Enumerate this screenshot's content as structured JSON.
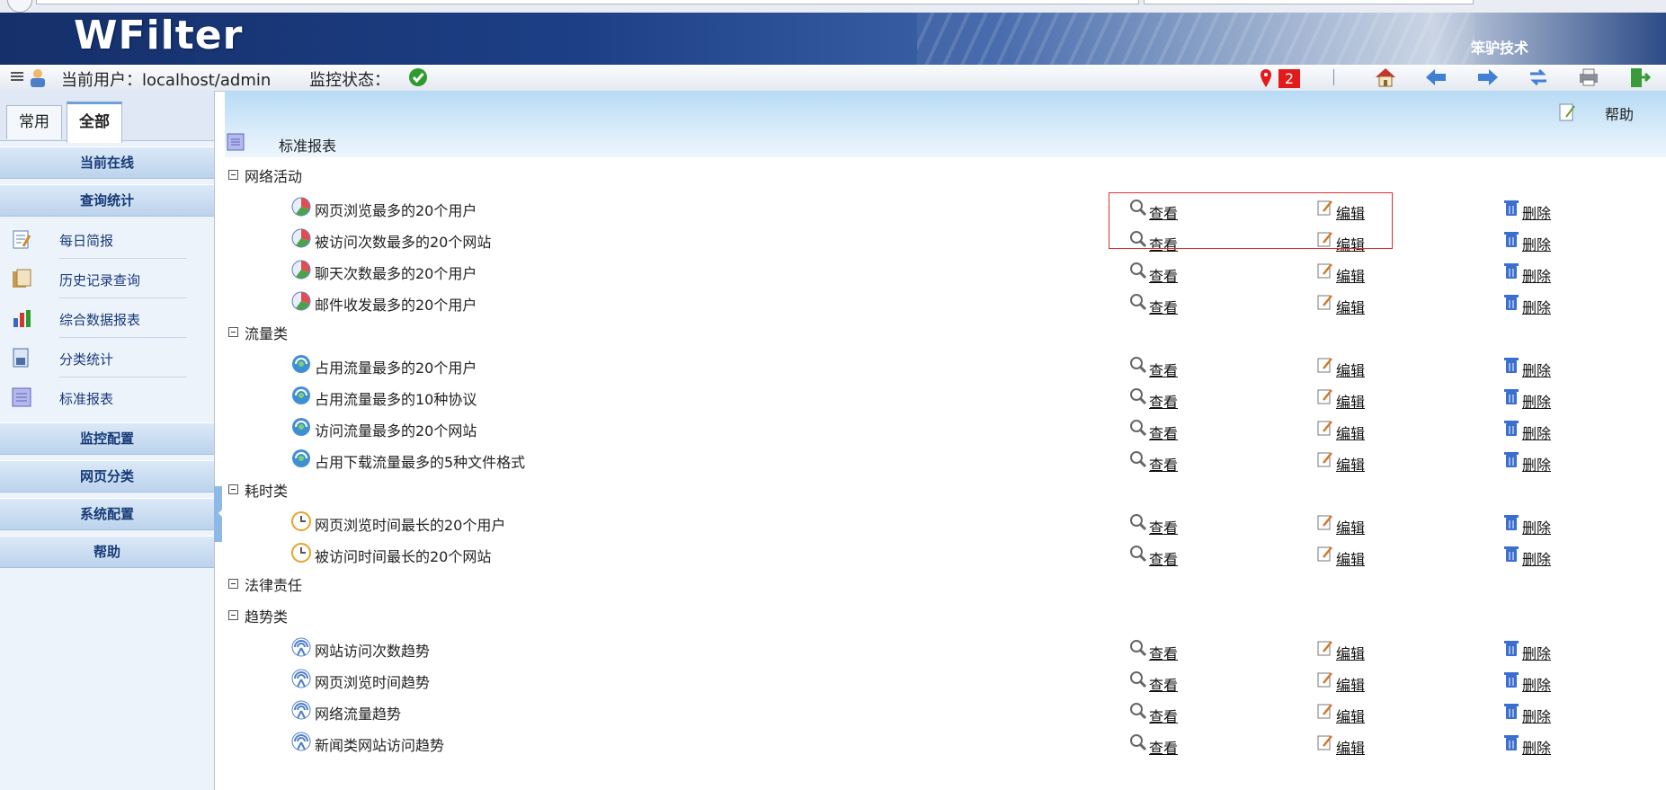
{
  "app": {
    "logo": "WFilter",
    "brand": "笨驴技术"
  },
  "statusbar": {
    "user_label": "当前用户：localhost/admin",
    "monitor_label": "监控状态：",
    "alert_count": "2"
  },
  "toolbar_icons": [
    "home-icon",
    "back-arrow-icon",
    "forward-arrow-icon",
    "refresh-icon",
    "print-icon",
    "exit-icon"
  ],
  "sidebar": {
    "tabs": [
      {
        "label": "常用"
      },
      {
        "label": "全部"
      }
    ],
    "sections": [
      {
        "label": "当前在线"
      },
      {
        "label": "查询统计"
      },
      {
        "label": "监控配置"
      },
      {
        "label": "网页分类"
      },
      {
        "label": "系统配置"
      },
      {
        "label": "帮助"
      }
    ],
    "items": [
      {
        "label": "每日简报",
        "icon": "daily-report-icon"
      },
      {
        "label": "历史记录查询",
        "icon": "history-query-icon"
      },
      {
        "label": "综合数据报表",
        "icon": "bar-chart-icon"
      },
      {
        "label": "分类统计",
        "icon": "category-stats-icon"
      },
      {
        "label": "标准报表",
        "icon": "list-report-icon"
      }
    ]
  },
  "main": {
    "help_label": "帮助",
    "page_title": "标准报表",
    "actions": {
      "view": "查看",
      "edit": "编辑",
      "delete": "删除"
    },
    "groups": [
      {
        "name": "网络活动",
        "icon": "pie-chart-icon",
        "reports": [
          "网页浏览最多的20个用户",
          "被访问次数最多的20个网站",
          "聊天次数最多的20个用户",
          "邮件收发最多的20个用户"
        ]
      },
      {
        "name": "流量类",
        "icon": "traffic-icon",
        "reports": [
          "占用流量最多的20个用户",
          "占用流量最多的10种协议",
          "访问流量最多的20个网站",
          "占用下载流量最多的5种文件格式"
        ]
      },
      {
        "name": "耗时类",
        "icon": "clock-icon",
        "reports": [
          "网页浏览时间最长的20个用户",
          "被访问时间最长的20个网站"
        ]
      },
      {
        "name": "法律责任",
        "icon": "",
        "reports": []
      },
      {
        "name": "趋势类",
        "icon": "trend-icon",
        "reports": [
          "网站访问次数趋势",
          "网页浏览时间趋势",
          "网络流量趋势",
          "新闻类网站访问趋势"
        ]
      }
    ]
  },
  "colors": {
    "banner": "#1d3f86",
    "nav_text": "#1a3a7c",
    "alert": "#e21a1a",
    "highlight": "#e0302f"
  }
}
